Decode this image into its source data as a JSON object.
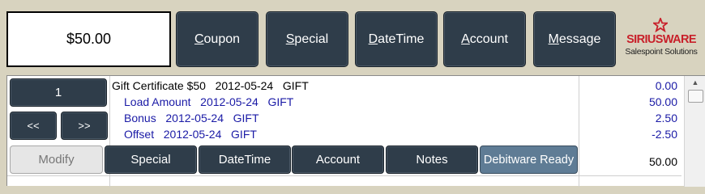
{
  "amount_display": "$50.00",
  "top_buttons": [
    {
      "hot": "C",
      "rest": "oupon"
    },
    {
      "hot": "S",
      "rest": "pecial"
    },
    {
      "hot": "D",
      "rest": "ateTime"
    },
    {
      "hot": "A",
      "rest": "ccount"
    },
    {
      "hot": "M",
      "rest": "essage"
    }
  ],
  "logo": {
    "brand": "SIRIUSWARE",
    "tagline": "Salespoint Solutions"
  },
  "quantity": "1",
  "nav": {
    "prev": "<<",
    "next": ">>"
  },
  "lines": [
    {
      "text": "Gift Certificate $50   2012-05-24   GIFT",
      "amount": "0.00",
      "style": "main"
    },
    {
      "text": "Load Amount   2012-05-24   GIFT",
      "amount": "50.00",
      "style": "sub"
    },
    {
      "text": "Bonus   2012-05-24   GIFT",
      "amount": "2.50",
      "style": "sub"
    },
    {
      "text": "Offset   2012-05-24   GIFT",
      "amount": "-2.50",
      "style": "sub"
    }
  ],
  "total": "50.00",
  "bottom_buttons": {
    "modify": "Modify",
    "special": "Special",
    "datetime": "DateTime",
    "account": "Account",
    "notes": "Notes",
    "ready": "Debitware Ready"
  },
  "scroll_up_glyph": "▲",
  "colors": {
    "button_dark": "#2f3d4a",
    "ready_button": "#5f7c95",
    "background": "#d8d3bf",
    "line_text": "#1a1aa6",
    "brand_red": "#c8202a"
  }
}
